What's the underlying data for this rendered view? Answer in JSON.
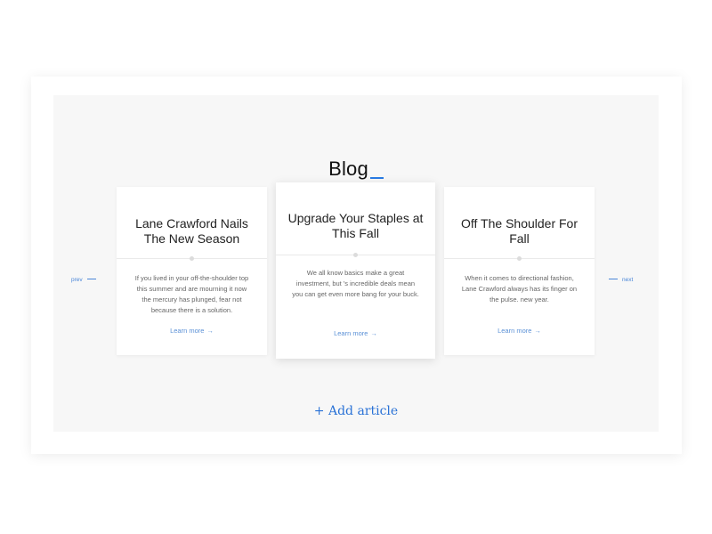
{
  "blog": {
    "title": "Blog",
    "nav": {
      "prev": "prev",
      "next": "next"
    },
    "cards": [
      {
        "title": "Lane Crawford Nails The New Season",
        "excerpt": "If you lived in your off-the-shoulder top this summer and are mourning it now the mercury has plunged, fear not because there is a solution.",
        "link": "Learn more"
      },
      {
        "title": "Upgrade Your Staples at This Fall",
        "excerpt": "We all know basics make a great investment, but 's incredible deals mean you can get even more bang for your buck.",
        "link": "Learn more"
      },
      {
        "title": "Off The Shoulder For Fall",
        "excerpt": "When it comes to directional fashion, Lane Crawford always has its finger on the pulse. new year.",
        "link": "Learn more"
      }
    ],
    "add_article": "+ Add article",
    "link_arrow": "→"
  },
  "colors": {
    "accent": "#2a7be4",
    "link": "#5a90d6",
    "stage_bg": "#f7f7f7"
  }
}
